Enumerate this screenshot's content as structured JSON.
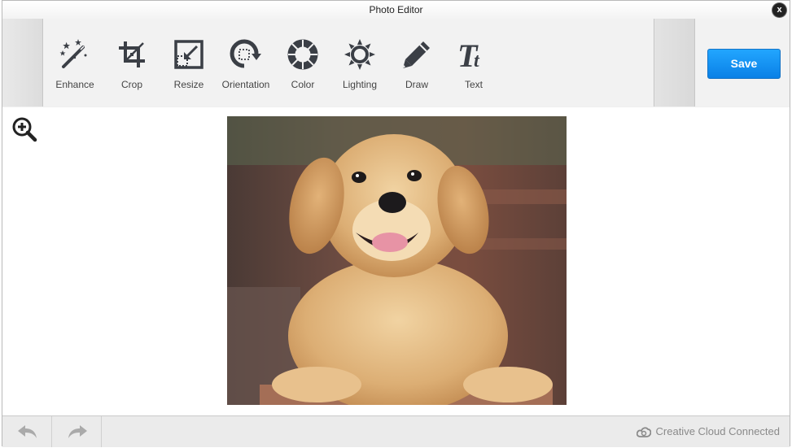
{
  "window": {
    "title": "Photo Editor",
    "close_label": "x"
  },
  "toolbar": {
    "tools": [
      {
        "label": "Enhance",
        "icon": "magic-wand-icon"
      },
      {
        "label": "Crop",
        "icon": "crop-icon"
      },
      {
        "label": "Resize",
        "icon": "resize-icon"
      },
      {
        "label": "Orientation",
        "icon": "rotate-icon"
      },
      {
        "label": "Color",
        "icon": "color-wheel-icon"
      },
      {
        "label": "Lighting",
        "icon": "sun-icon"
      },
      {
        "label": "Draw",
        "icon": "pencil-icon"
      },
      {
        "label": "Text",
        "icon": "text-icon"
      }
    ],
    "save_label": "Save"
  },
  "canvas": {
    "zoom_icon": "zoom-in-icon",
    "image_subject": "golden retriever puppy photo"
  },
  "footer": {
    "undo_icon": "undo-icon",
    "redo_icon": "redo-icon",
    "status": "Creative Cloud Connected"
  },
  "colors": {
    "accent": "#1a90f0",
    "icon": "#3b3f46"
  }
}
